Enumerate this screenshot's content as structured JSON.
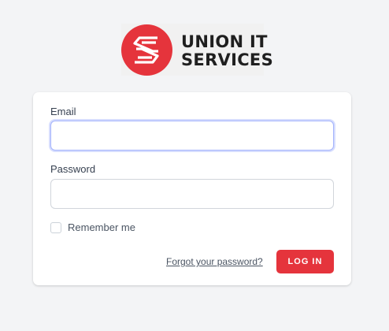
{
  "brand": {
    "name_line1": "UNION IT",
    "name_line2": "SERVICES",
    "accent_color": "#e5343c",
    "logo_icon": "stacked-s-logo-icon"
  },
  "form": {
    "email_label": "Email",
    "email_value": "",
    "password_label": "Password",
    "password_value": "",
    "remember_label": "Remember me",
    "remember_checked": false,
    "forgot_link": "Forgot your password?",
    "submit_label": "LOG IN"
  }
}
